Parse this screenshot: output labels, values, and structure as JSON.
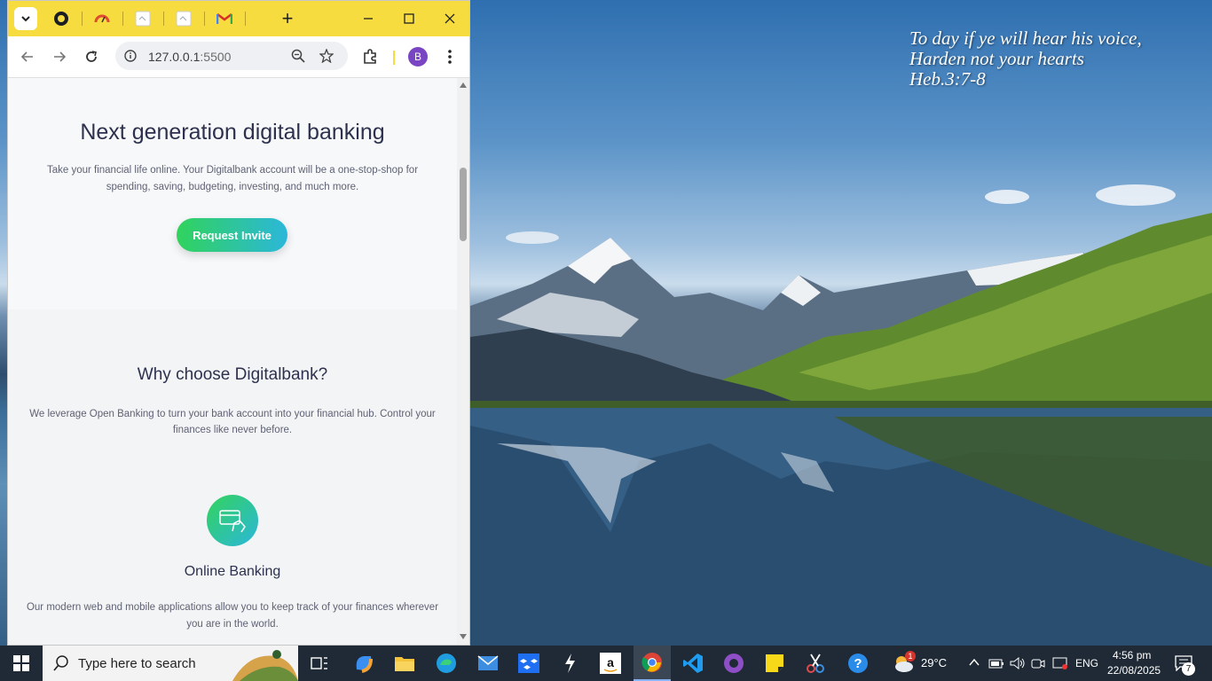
{
  "desktop": {
    "verse_lines": [
      "To day if ye will hear his voice,",
      "Harden not your hearts",
      "Heb.3:7-8"
    ]
  },
  "browser": {
    "tabs": [
      "github-tab-icon",
      "speedometer-tab-icon",
      "page-tab-icon",
      "page-tab-icon",
      "gmail-tab-icon"
    ],
    "new_tab_label": "+",
    "url_host": "127.0.0.1",
    "url_port": ":5500",
    "avatar_letter": "B",
    "colors": {
      "tabstrip": "#f6dc3e",
      "avatar": "#7a45c2"
    }
  },
  "page": {
    "hero_title": "Next generation digital banking",
    "hero_text": "Take your financial life online. Your Digitalbank account will be a one-stop-shop for spending, saving, budgeting, investing, and much more.",
    "cta_label": "Request Invite",
    "why_title": "Why choose Digitalbank?",
    "why_text": "We leverage Open Banking to turn your bank account into your financial hub. Control your finances like never before.",
    "feature_title": "Online Banking",
    "feature_text": "Our modern web and mobile applications allow you to keep track of your finances wherever you are in the world.",
    "colors": {
      "cta_from": "#31d35c",
      "cta_to": "#2bb7da",
      "heading": "#2d314d"
    }
  },
  "taskbar": {
    "search_placeholder": "Type here to search",
    "weather_temp": "29°C",
    "language": "ENG",
    "time": "4:56 pm",
    "date": "22/08/2025",
    "notification_count": "7",
    "weather_badge": "1"
  }
}
